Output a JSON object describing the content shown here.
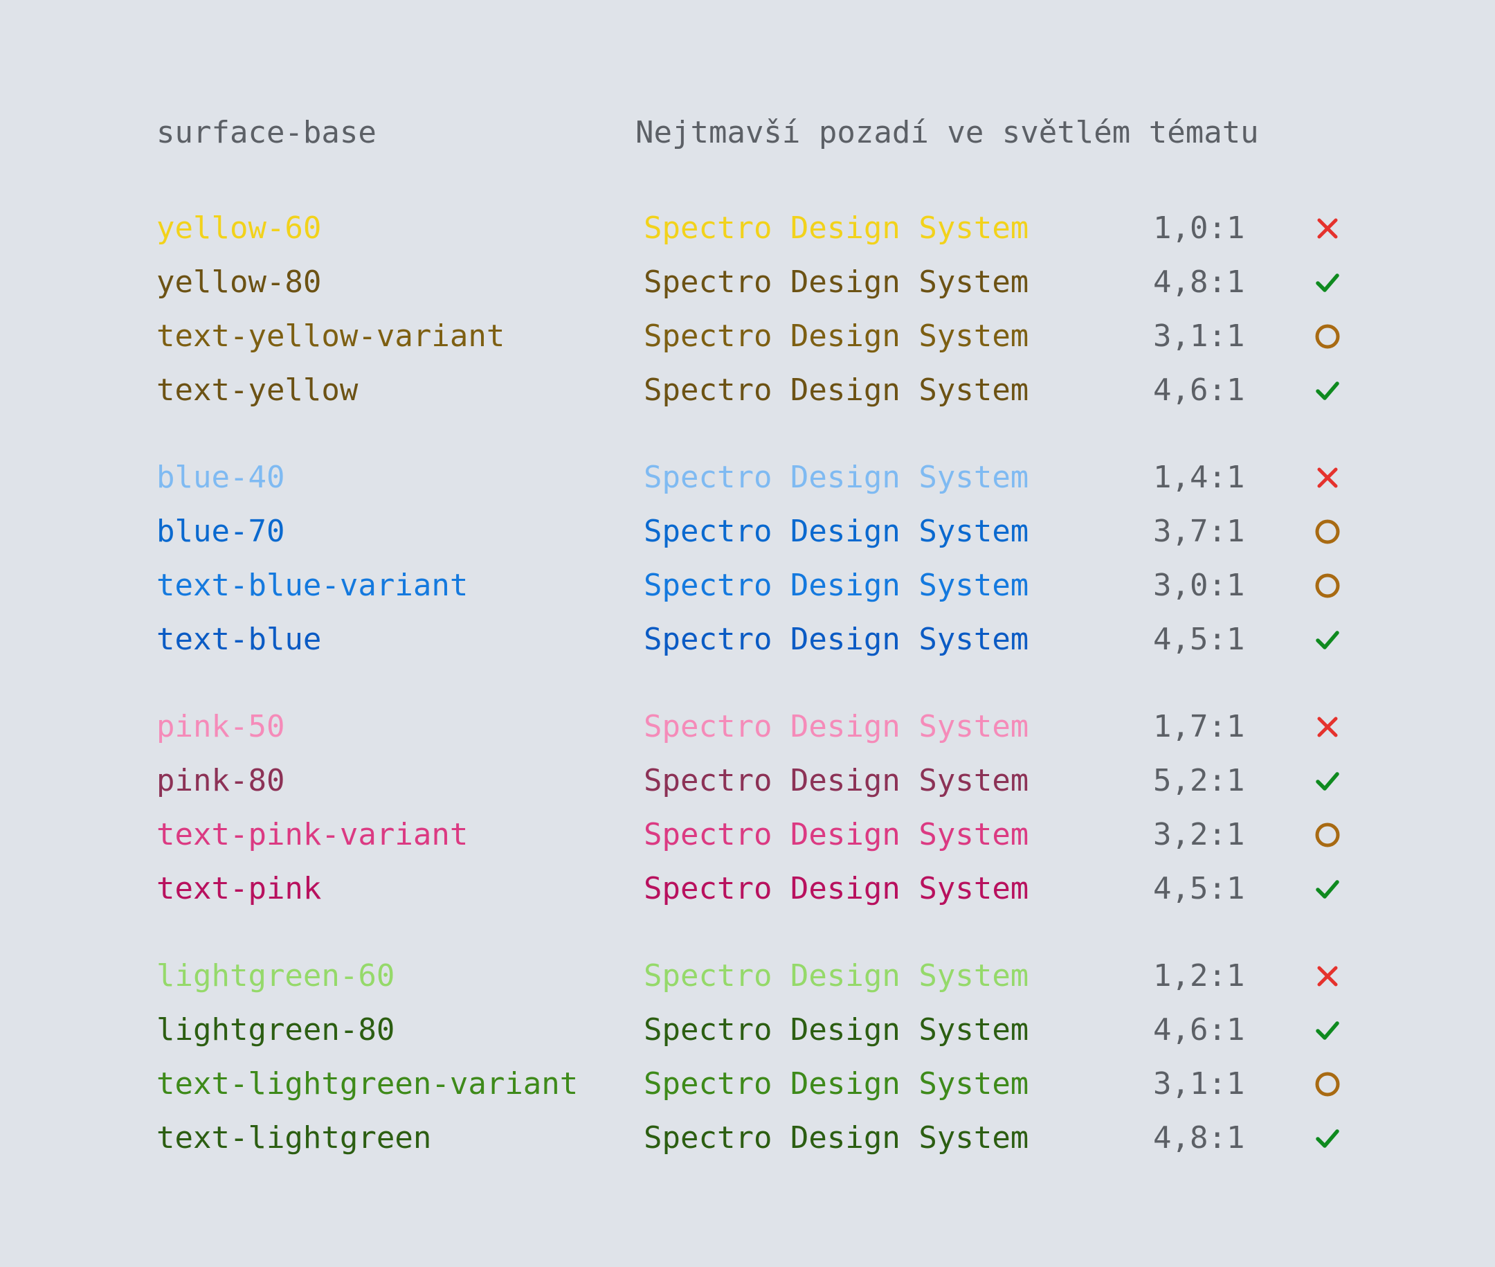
{
  "header": {
    "name": "surface-base",
    "description": "Nejtmavší pozadí ve světlém tématu"
  },
  "status_colors": {
    "fail": "#e5322d",
    "pass": "#0f8a1f",
    "partial": "#a86a12"
  },
  "groups": [
    {
      "rows": [
        {
          "name": "yellow-60",
          "sample": "Spectro Design System",
          "ratio": "1,0:1",
          "status": "fail",
          "color": "#f2d21b"
        },
        {
          "name": "yellow-80",
          "sample": "Spectro Design System",
          "ratio": "4,8:1",
          "status": "pass",
          "color": "#6c5214"
        },
        {
          "name": "text-yellow-variant",
          "sample": "Spectro Design System",
          "ratio": "3,1:1",
          "status": "partial",
          "color": "#7d5f12"
        },
        {
          "name": "text-yellow",
          "sample": "Spectro Design System",
          "ratio": "4,6:1",
          "status": "pass",
          "color": "#6c5214"
        }
      ]
    },
    {
      "rows": [
        {
          "name": "blue-40",
          "sample": "Spectro Design System",
          "ratio": "1,4:1",
          "status": "fail",
          "color": "#7fbaf2"
        },
        {
          "name": "blue-70",
          "sample": "Spectro Design System",
          "ratio": "3,7:1",
          "status": "partial",
          "color": "#0a69cf"
        },
        {
          "name": "text-blue-variant",
          "sample": "Spectro Design System",
          "ratio": "3,0:1",
          "status": "partial",
          "color": "#1479de"
        },
        {
          "name": "text-blue",
          "sample": "Spectro Design System",
          "ratio": "4,5:1",
          "status": "pass",
          "color": "#0b5bc4"
        }
      ]
    },
    {
      "rows": [
        {
          "name": "pink-50",
          "sample": "Spectro Design System",
          "ratio": "1,7:1",
          "status": "fail",
          "color": "#f58bb9"
        },
        {
          "name": "pink-80",
          "sample": "Spectro Design System",
          "ratio": "5,2:1",
          "status": "pass",
          "color": "#8c3256"
        },
        {
          "name": "text-pink-variant",
          "sample": "Spectro Design System",
          "ratio": "3,2:1",
          "status": "partial",
          "color": "#db3a82"
        },
        {
          "name": "text-pink",
          "sample": "Spectro Design System",
          "ratio": "4,5:1",
          "status": "pass",
          "color": "#b8115e"
        }
      ]
    },
    {
      "rows": [
        {
          "name": "lightgreen-60",
          "sample": "Spectro Design System",
          "ratio": "1,2:1",
          "status": "fail",
          "color": "#95d96a"
        },
        {
          "name": "lightgreen-80",
          "sample": "Spectro Design System",
          "ratio": "4,6:1",
          "status": "pass",
          "color": "#2c5e12"
        },
        {
          "name": "text-lightgreen-variant",
          "sample": "Spectro Design System",
          "ratio": "3,1:1",
          "status": "partial",
          "color": "#3e8a1a"
        },
        {
          "name": "text-lightgreen",
          "sample": "Spectro Design System",
          "ratio": "4,8:1",
          "status": "pass",
          "color": "#2c5e12"
        }
      ]
    }
  ]
}
